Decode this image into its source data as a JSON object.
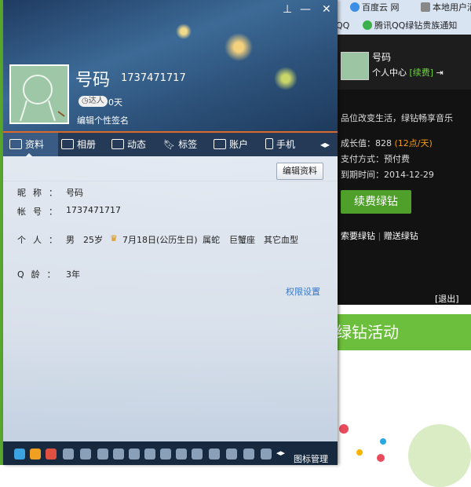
{
  "browser": {
    "tab1": "百度云 网",
    "tab2": "本地用户消",
    "tab3": "QQ",
    "tab4": "腾讯QQ绿钻贵族通知"
  },
  "qqmusic": {
    "number": "号码",
    "center": "个人中心",
    "renew_link": "[续费]",
    "slogan": "品位改变生活，绿钻畅享音乐",
    "growth_label": "成长值：",
    "growth_value": "828",
    "growth_rate": "(12点/天)",
    "pay_label": "支付方式：",
    "pay_value": "预付费",
    "expire_label": "到期时间：",
    "expire_value": "2014-12-29",
    "renew_button": "续费绿钻",
    "link_request": "索要绿钻",
    "link_gift": "赠送绿钻",
    "logout": "[退出]",
    "banner": "绿钻活动"
  },
  "profile": {
    "nickname": "号码",
    "qq_number": "1737471717",
    "badge": "达人",
    "days": "0天",
    "signature": "编辑个性签名",
    "tabs": [
      "资料",
      "相册",
      "动态",
      "标签",
      "账户",
      "手机"
    ],
    "edit_button": "编辑资料",
    "fields": {
      "nick_label": "昵称：",
      "nick_value": "号码",
      "account_label": "帐号：",
      "account_value": "1737471717",
      "personal_label": "个人：",
      "gender": "男",
      "age": "25岁",
      "birthday": "7月18日(公历生日)",
      "zodiac": "属蛇",
      "star": "巨蟹座",
      "blood": "其它血型",
      "qage_label": "Q龄：",
      "qage_value": "3年"
    },
    "permission": "权限设置",
    "bottom_text": "图标管理"
  }
}
